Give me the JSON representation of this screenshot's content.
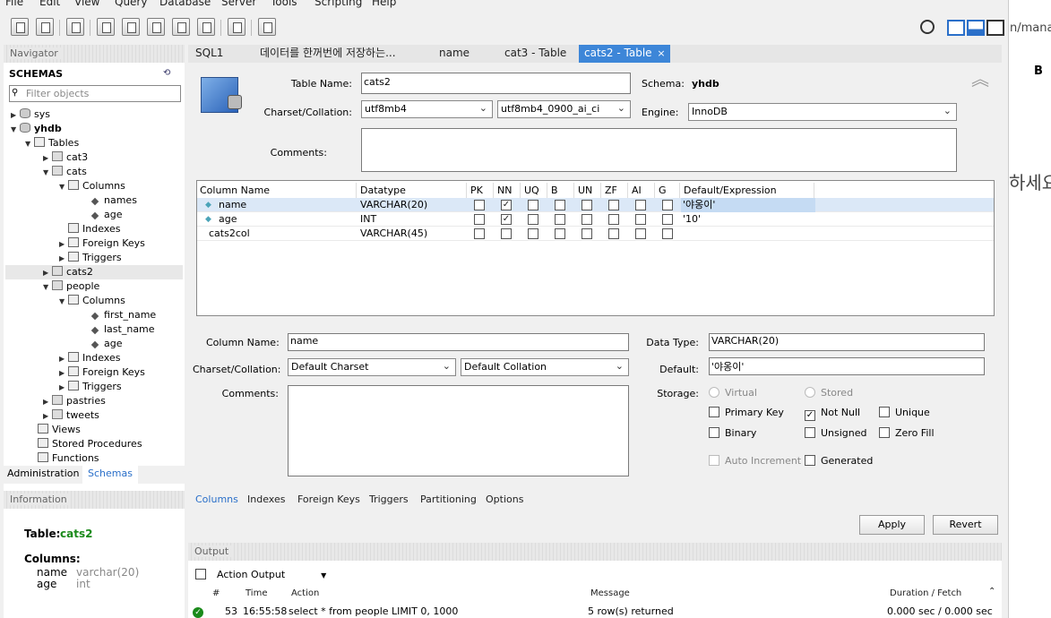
{
  "menu": [
    "File",
    "Edit",
    "View",
    "Query",
    "Database",
    "Server",
    "Tools",
    "Scripting",
    "Help"
  ],
  "navigator": {
    "title": "Navigator",
    "schemas_label": "SCHEMAS",
    "filter_placeholder": "Filter objects",
    "tree": {
      "sys": "sys",
      "yhdb": "yhdb",
      "tables": "Tables",
      "cat3": "cat3",
      "cats": "cats",
      "columns": "Columns",
      "names": "names",
      "age": "age",
      "indexes": "Indexes",
      "foreign_keys": "Foreign Keys",
      "triggers": "Triggers",
      "cats2": "cats2",
      "people": "people",
      "first_name": "first_name",
      "last_name": "last_name",
      "pastries": "pastries",
      "tweets": "tweets",
      "views": "Views",
      "stored_procedures": "Stored Procedures",
      "functions": "Functions"
    },
    "bottom_tabs": [
      "Administration",
      "Schemas"
    ]
  },
  "information": {
    "title": "Information",
    "table_label": "Table:",
    "table_name": "cats2",
    "columns_label": "Columns:",
    "columns": [
      {
        "name": "name",
        "type": "varchar(20)"
      },
      {
        "name": "age",
        "type": "int"
      }
    ]
  },
  "tabs": [
    "SQL1",
    "데이터를 한꺼번에 저장하는...",
    "name",
    "cat3 - Table",
    "cats2 - Table"
  ],
  "table_editor": {
    "table_name_label": "Table Name:",
    "table_name": "cats2",
    "schema_label": "Schema:",
    "schema": "yhdb",
    "charset_label": "Charset/Collation:",
    "charset": "utf8mb4",
    "collation": "utf8mb4_0900_ai_ci",
    "engine_label": "Engine:",
    "engine": "InnoDB",
    "comments_label": "Comments:"
  },
  "grid": {
    "headers": [
      "Column Name",
      "Datatype",
      "PK",
      "NN",
      "UQ",
      "B",
      "UN",
      "ZF",
      "AI",
      "G",
      "Default/Expression"
    ],
    "rows": [
      {
        "name": "name",
        "type": "VARCHAR(20)",
        "flags": [
          false,
          true,
          false,
          false,
          false,
          false,
          false,
          false
        ],
        "default": "'야옹이'"
      },
      {
        "name": "age",
        "type": "INT",
        "flags": [
          false,
          true,
          false,
          false,
          false,
          false,
          false,
          false
        ],
        "default": "'10'"
      },
      {
        "name": "cats2col",
        "type": "VARCHAR(45)",
        "flags": [
          false,
          false,
          false,
          false,
          false,
          false,
          false,
          false
        ],
        "default": ""
      }
    ]
  },
  "column_details": {
    "column_name_label": "Column Name:",
    "column_name": "name",
    "charset_label": "Charset/Collation:",
    "charset": "Default Charset",
    "collation": "Default Collation",
    "comments_label": "Comments:",
    "data_type_label": "Data Type:",
    "data_type": "VARCHAR(20)",
    "default_label": "Default:",
    "default": "'야옹이'",
    "storage_label": "Storage:",
    "virtual": "Virtual",
    "stored": "Stored",
    "primary_key": "Primary Key",
    "not_null": "Not Null",
    "unique": "Unique",
    "binary": "Binary",
    "unsigned": "Unsigned",
    "zero_fill": "Zero Fill",
    "auto_increment": "Auto Increment",
    "generated": "Generated"
  },
  "bottom_tabs": [
    "Columns",
    "Indexes",
    "Foreign Keys",
    "Triggers",
    "Partitioning",
    "Options"
  ],
  "buttons": {
    "apply": "Apply",
    "revert": "Revert"
  },
  "output": {
    "title": "Output",
    "selector": "Action Output",
    "headers": [
      "#",
      "Time",
      "Action",
      "Message",
      "Duration / Fetch"
    ],
    "rows": [
      {
        "num": "53",
        "time": "16:55:58",
        "action": "select * from people LIMIT 0, 1000",
        "message": "5 row(s) returned",
        "duration": "0.000 sec / 0.000 sec"
      }
    ]
  },
  "right_strip": {
    "url_fragment": "n/mana",
    "b_label": "B",
    "text_fragment": "하세요"
  },
  "colors": {
    "accent": "#3d86d8",
    "selected_row": "#dbe8f7",
    "green": "#1a8a1a"
  }
}
